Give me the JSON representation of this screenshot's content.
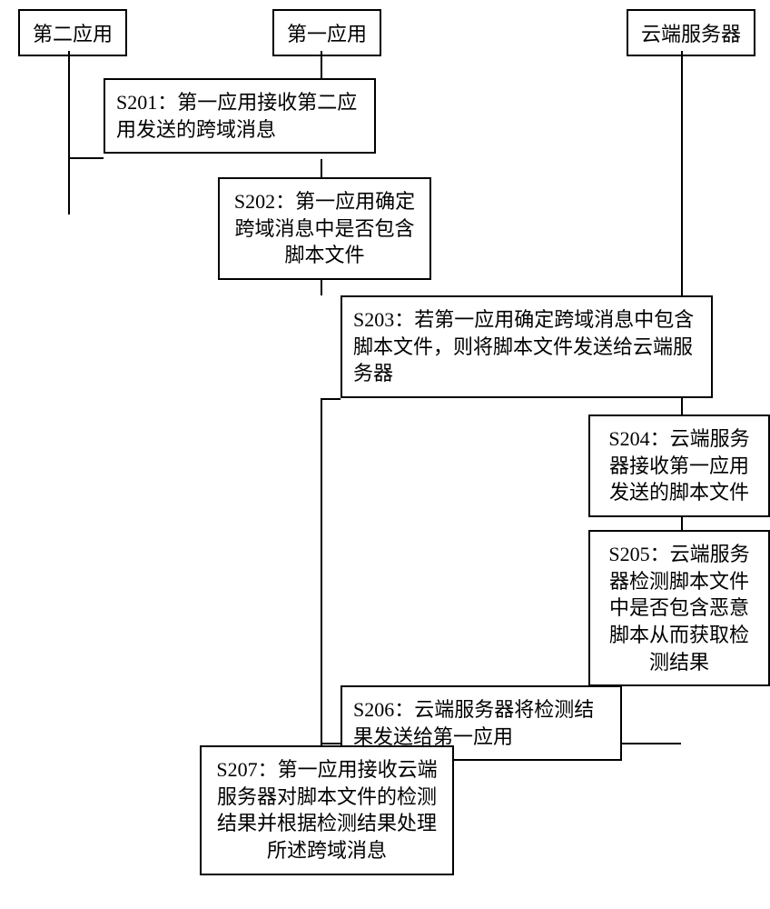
{
  "actors": {
    "second_app": "第二应用",
    "first_app": "第一应用",
    "cloud_server": "云端服务器"
  },
  "messages": {
    "s201": "S201：第一应用接收第二应用发送的跨域消息",
    "s202": "S202：第一应用确定跨域消息中是否包含脚本文件",
    "s203": "S203：若第一应用确定跨域消息中包含脚本文件，则将脚本文件发送给云端服务器",
    "s204": "S204：云端服务器接收第一应用发送的脚本文件",
    "s205": "S205：云端服务器检测脚本文件中是否包含恶意脚本从而获取检测结果",
    "s206": "S206：云端服务器将检测结果发送给第一应用",
    "s207": "S207：第一应用接收云端服务器对脚本文件的检测结果并根据检测结果处理所述跨域消息"
  }
}
